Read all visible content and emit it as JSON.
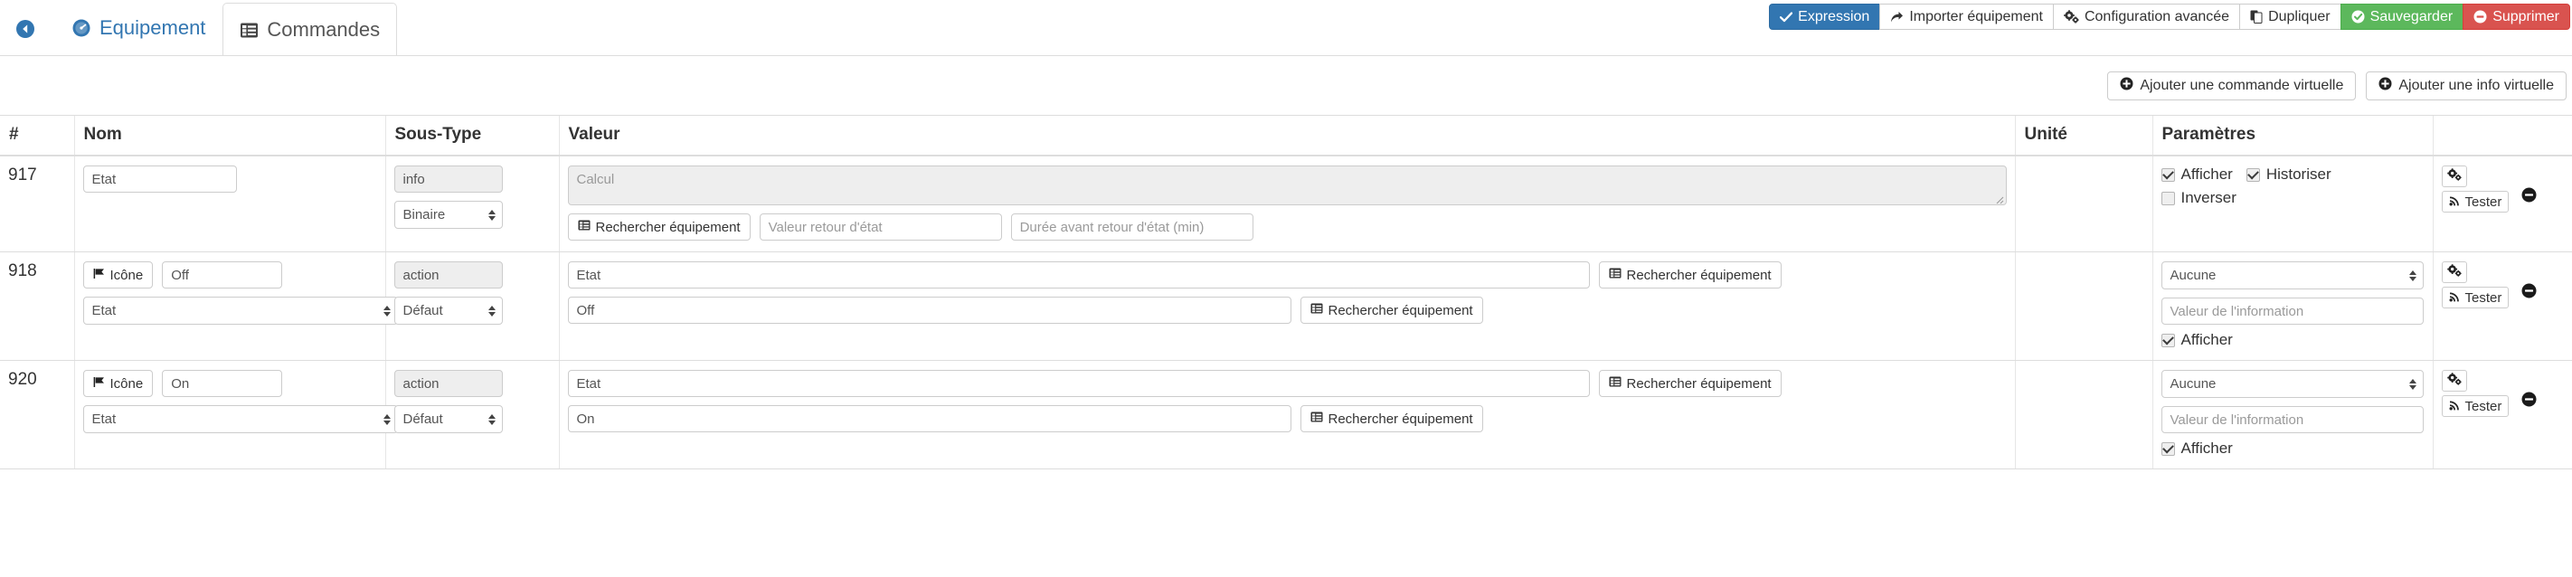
{
  "header": {
    "back_icon": "back-arrow-circle-icon",
    "tabs": [
      {
        "label": "Equipement",
        "icon": "dashboard-icon",
        "active": false
      },
      {
        "label": "Commandes",
        "icon": "list-table-icon",
        "active": true
      }
    ],
    "toolbar": [
      {
        "label": "Expression",
        "icon": "check-icon",
        "style": "primary"
      },
      {
        "label": "Importer équipement",
        "icon": "share-arrow-icon",
        "style": "default"
      },
      {
        "label": "Configuration avancée",
        "icon": "gears-icon",
        "style": "default"
      },
      {
        "label": "Dupliquer",
        "icon": "copy-file-icon",
        "style": "default"
      },
      {
        "label": "Sauvegarder",
        "icon": "check-circle-icon",
        "style": "success"
      },
      {
        "label": "Supprimer",
        "icon": "minus-circle-icon",
        "style": "danger"
      }
    ],
    "toolbar_second": [
      {
        "label": "Ajouter une commande virtuelle",
        "icon": "plus-circle-icon"
      },
      {
        "label": "Ajouter une info virtuelle",
        "icon": "plus-circle-icon"
      }
    ]
  },
  "table": {
    "columns": [
      "#",
      "Nom",
      "Sous-Type",
      "Valeur",
      "Unité",
      "Paramètres",
      ""
    ],
    "labels": {
      "rechercher": "Rechercher équipement",
      "tester": "Tester",
      "icone": "Icône",
      "afficher": "Afficher",
      "historiser": "Historiser",
      "inverser": "Inverser"
    },
    "rows": [
      {
        "id": "917",
        "type": "info",
        "name_value": "Etat",
        "subtype_readonly": "info",
        "subtype_select": "Binaire",
        "calcul_placeholder": "Calcul",
        "valeur_retour_placeholder": "Valeur retour d'état",
        "duree_placeholder": "Durée avant retour d'état (min)",
        "unite": "",
        "checks": [
          {
            "label": "Afficher",
            "checked": true
          },
          {
            "label": "Historiser",
            "checked": true
          },
          {
            "label": "Inverser",
            "checked": false
          }
        ]
      },
      {
        "id": "918",
        "type": "action",
        "icone_label": "Icône",
        "name_value": "Off",
        "name_select": "Etat",
        "subtype_readonly": "action",
        "subtype_select": "Défaut",
        "value_top": "Etat",
        "value_bottom": "Off",
        "unite": "",
        "param_select": "Aucune",
        "param_info_placeholder": "Valeur de l'information",
        "checks": [
          {
            "label": "Afficher",
            "checked": true
          }
        ]
      },
      {
        "id": "920",
        "type": "action",
        "icone_label": "Icône",
        "name_value": "On",
        "name_select": "Etat",
        "subtype_readonly": "action",
        "subtype_select": "Défaut",
        "value_top": "Etat",
        "value_bottom": "On",
        "unite": "",
        "param_select": "Aucune",
        "param_info_placeholder": "Valeur de l'information",
        "checks": [
          {
            "label": "Afficher",
            "checked": true
          }
        ]
      }
    ]
  },
  "colors": {
    "primary": "#3276b1",
    "success": "#5cb85c",
    "danger": "#d9534f",
    "link": "#3276b1",
    "border": "#dddddd",
    "disabled_bg": "#eeeeee"
  }
}
